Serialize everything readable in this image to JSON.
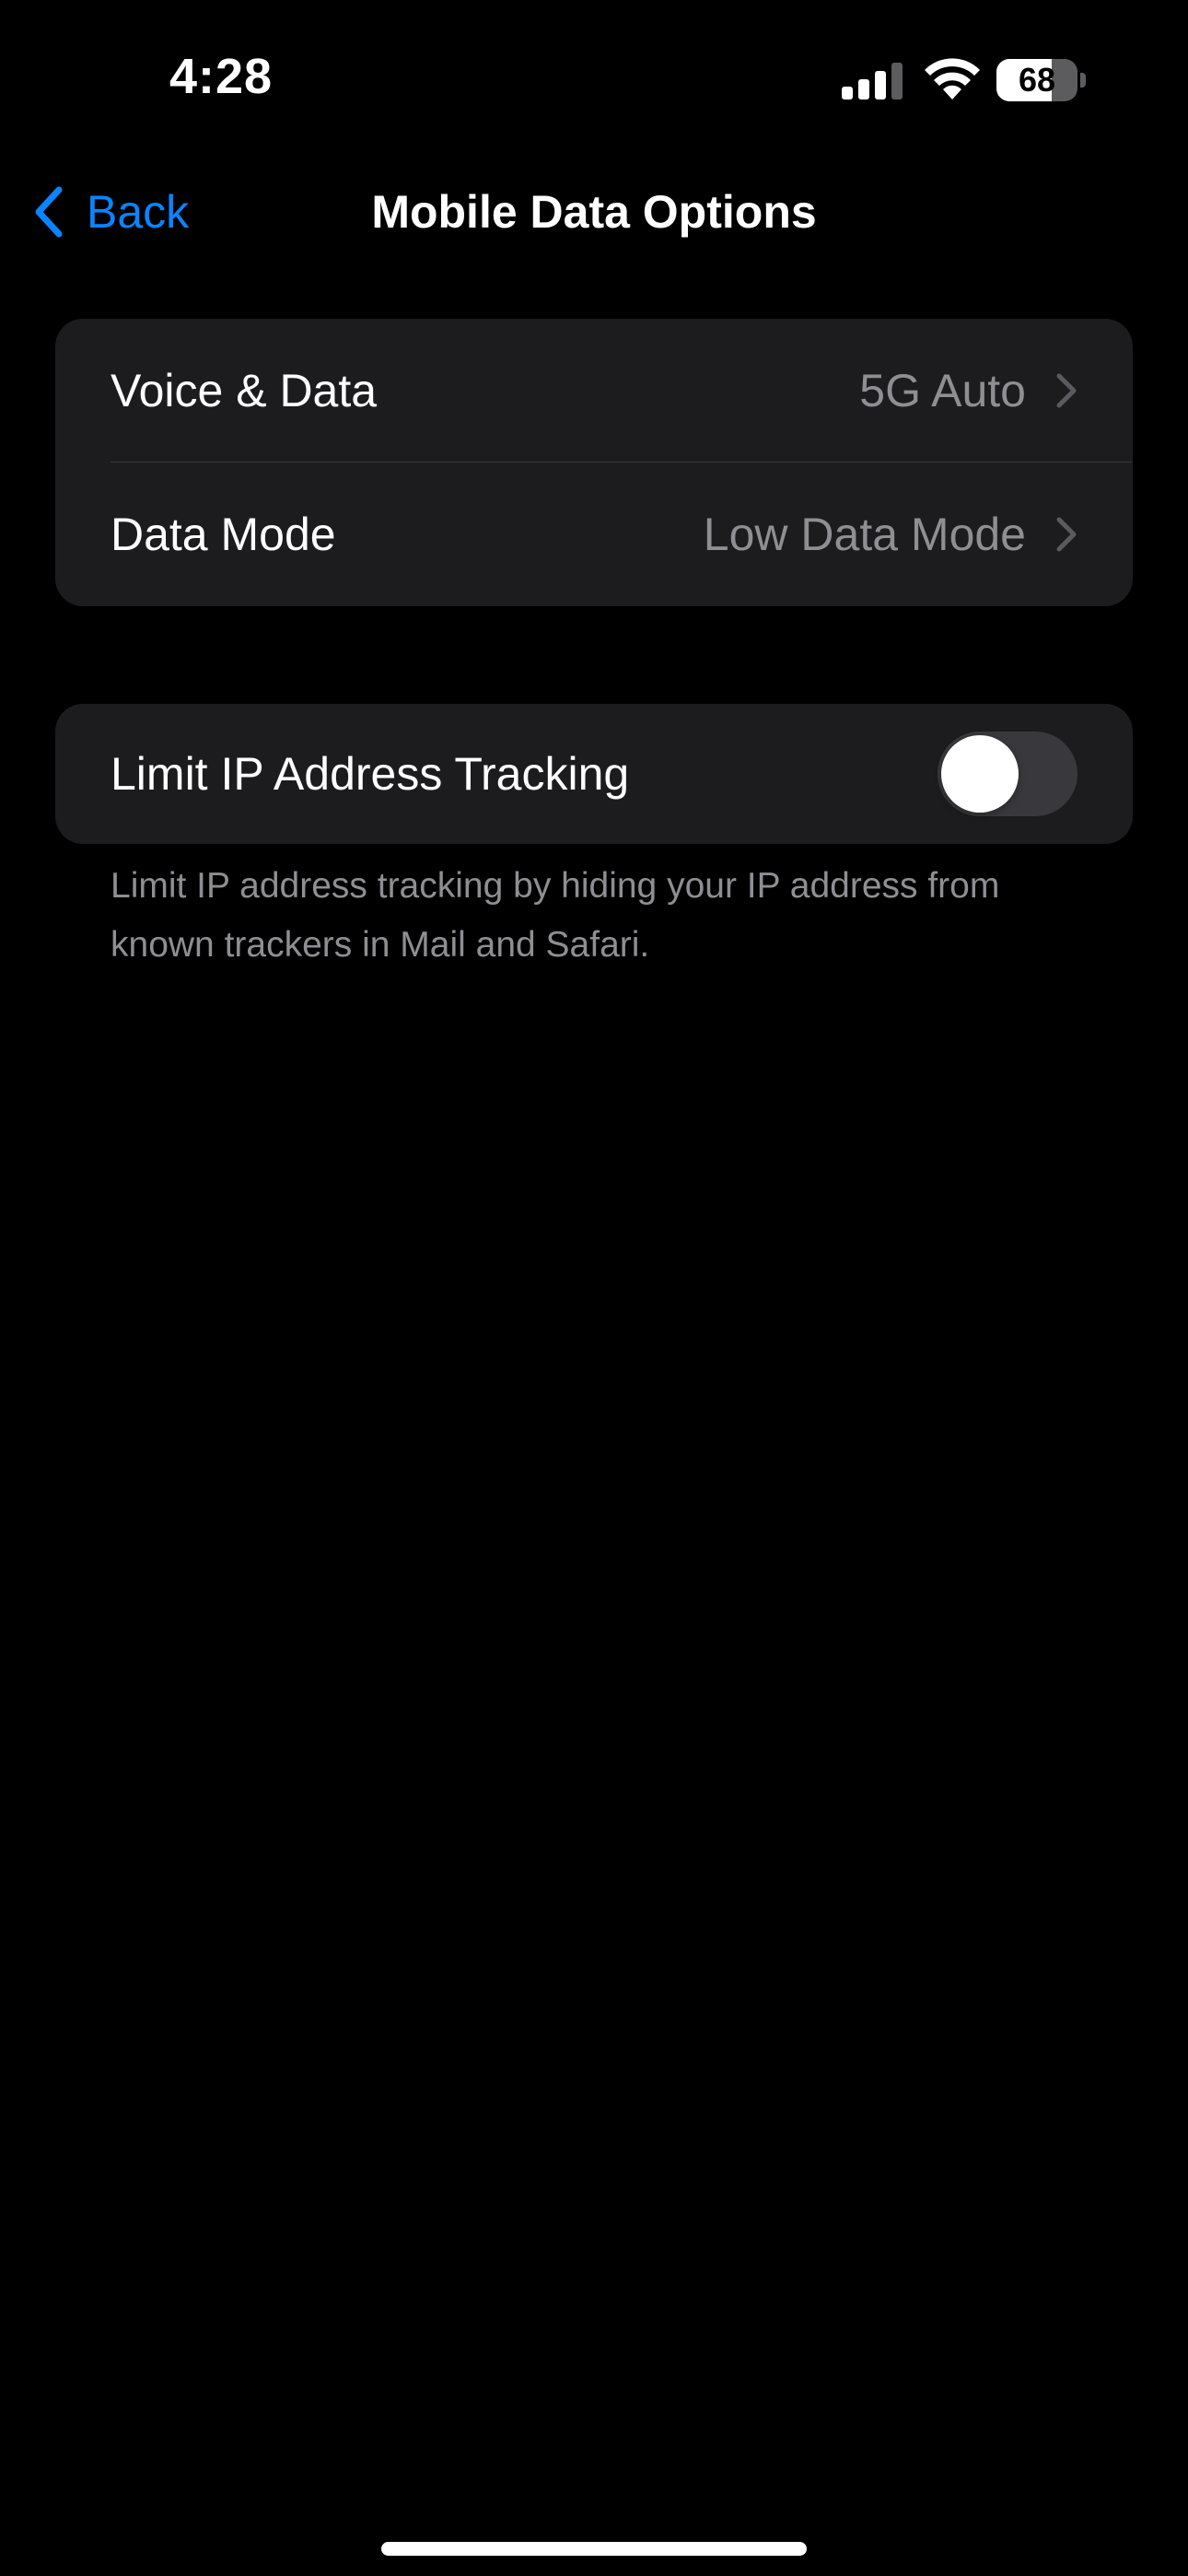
{
  "status_bar": {
    "time": "4:28",
    "battery_percent": "68",
    "battery_level": 0.68,
    "signal_icon": "cellular-signal-icon",
    "wifi_icon": "wifi-icon"
  },
  "nav": {
    "back_label": "Back",
    "title": "Mobile Data Options",
    "accent_color": "#0a84ff"
  },
  "settings_group": {
    "rows": [
      {
        "label": "Voice & Data",
        "value": "5G Auto"
      },
      {
        "label": "Data Mode",
        "value": "Low Data Mode"
      }
    ]
  },
  "privacy_group": {
    "label": "Limit IP Address Tracking",
    "toggle_on": false,
    "footer": "Limit IP address tracking by hiding your IP address from known trackers in Mail and Safari."
  }
}
